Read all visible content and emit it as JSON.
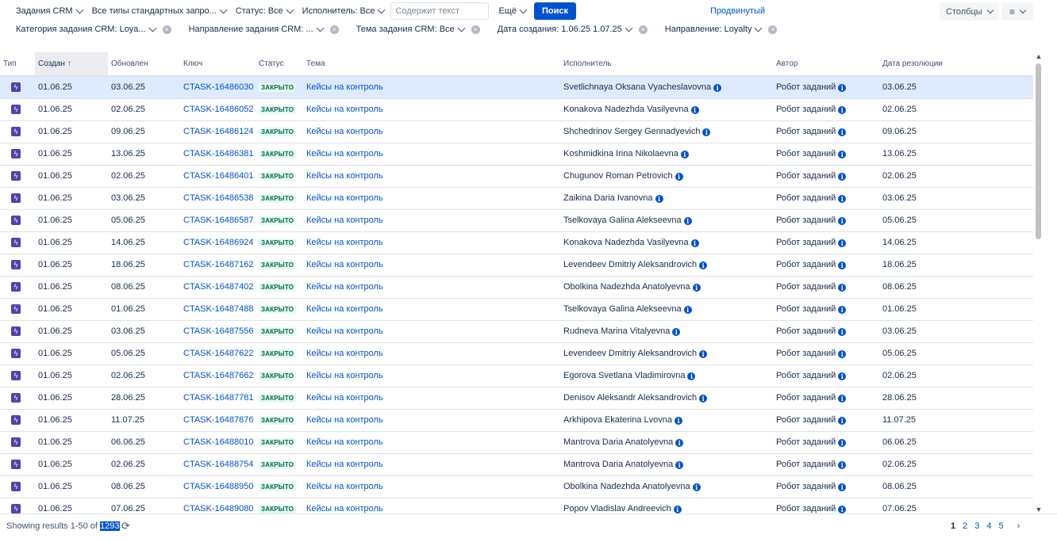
{
  "filters": {
    "row1": [
      {
        "name": "filter-project",
        "label": "Задания CRM"
      },
      {
        "name": "filter-request-type",
        "label": "Все типы стандартных запро..."
      },
      {
        "name": "filter-status",
        "label": "Статус: Все"
      },
      {
        "name": "filter-assignee",
        "label": "Исполнитель: Все"
      }
    ],
    "search_placeholder": "Содержит текст",
    "more_label": "Ещё",
    "search_button": "Поиск",
    "advanced_label": "Продвинутый",
    "columns_label": "Столбцы",
    "menu_icon": "≡",
    "row2": [
      {
        "name": "filter-task-category",
        "label": "Категория задания CRM: Loya..."
      },
      {
        "name": "filter-task-direction",
        "label": "Направление задания CRM: ..."
      },
      {
        "name": "filter-task-topic",
        "label": "Тема задания CRM: Все"
      },
      {
        "name": "filter-created-date",
        "label": "Дата создания: 1.06.25 1.07.25"
      },
      {
        "name": "filter-direction",
        "label": "Направление: Loyalty"
      }
    ]
  },
  "columns": [
    "Тип",
    "Создан",
    "Обновлен",
    "Ключ",
    "Статус",
    "Тема",
    "Исполнитель",
    "Автор",
    "Дата резолюции"
  ],
  "rows": [
    {
      "created": "01.06.25",
      "updated": "03.06.25",
      "key": "CTASK-16486030",
      "status": "ЗАКРЫТО",
      "summary": "Кейсы на контроль",
      "assignee": "Svetlichnaya Oksana Vyacheslavovna",
      "reporter": "Робот заданий",
      "resolved": "03.06.25"
    },
    {
      "created": "01.06.25",
      "updated": "02.06.25",
      "key": "CTASK-16486052",
      "status": "ЗАКРЫТО",
      "summary": "Кейсы на контроль",
      "assignee": "Konakova Nadezhda Vasilyevna",
      "reporter": "Робот заданий",
      "resolved": "02.06.25"
    },
    {
      "created": "01.06.25",
      "updated": "09.06.25",
      "key": "CTASK-16486124",
      "status": "ЗАКРЫТО",
      "summary": "Кейсы на контроль",
      "assignee": "Shchedrinov Sergey Gennadyevich",
      "reporter": "Робот заданий",
      "resolved": "09.06.25"
    },
    {
      "created": "01.06.25",
      "updated": "13.06.25",
      "key": "CTASK-16486381",
      "status": "ЗАКРЫТО",
      "summary": "Кейсы на контроль",
      "assignee": "Koshmidkina Irina Nikolaevna",
      "reporter": "Робот заданий",
      "resolved": "13.06.25"
    },
    {
      "created": "01.06.25",
      "updated": "02.06.25",
      "key": "CTASK-16486401",
      "status": "ЗАКРЫТО",
      "summary": "Кейсы на контроль",
      "assignee": "Chugunov Roman Petrovich",
      "reporter": "Робот заданий",
      "resolved": "02.06.25"
    },
    {
      "created": "01.06.25",
      "updated": "03.06.25",
      "key": "CTASK-16486538",
      "status": "ЗАКРЫТО",
      "summary": "Кейсы на контроль",
      "assignee": "Zaikina Daria Ivanovna",
      "reporter": "Робот заданий",
      "resolved": "03.06.25"
    },
    {
      "created": "01.06.25",
      "updated": "05.06.25",
      "key": "CTASK-16486587",
      "status": "ЗАКРЫТО",
      "summary": "Кейсы на контроль",
      "assignee": "Tselkovaya Galina Alekseevna",
      "reporter": "Робот заданий",
      "resolved": "05.06.25"
    },
    {
      "created": "01.06.25",
      "updated": "14.06.25",
      "key": "CTASK-16486924",
      "status": "ЗАКРЫТО",
      "summary": "Кейсы на контроль",
      "assignee": "Konakova Nadezhda Vasilyevna",
      "reporter": "Робот заданий",
      "resolved": "14.06.25"
    },
    {
      "created": "01.06.25",
      "updated": "18.06.25",
      "key": "CTASK-16487162",
      "status": "ЗАКРЫТО",
      "summary": "Кейсы на контроль",
      "assignee": "Levendeev Dmitriy Aleksandrovich",
      "reporter": "Робот заданий",
      "resolved": "18.06.25"
    },
    {
      "created": "01.06.25",
      "updated": "08.06.25",
      "key": "CTASK-16487402",
      "status": "ЗАКРЫТО",
      "summary": "Кейсы на контроль",
      "assignee": "Obolkina Nadezhda Anatolyevna",
      "reporter": "Робот заданий",
      "resolved": "08.06.25"
    },
    {
      "created": "01.06.25",
      "updated": "01.06.25",
      "key": "CTASK-16487488",
      "status": "ЗАКРЫТО",
      "summary": "Кейсы на контроль",
      "assignee": "Tselkovaya Galina Alekseevna",
      "reporter": "Робот заданий",
      "resolved": "01.06.25"
    },
    {
      "created": "01.06.25",
      "updated": "03.06.25",
      "key": "CTASK-16487556",
      "status": "ЗАКРЫТО",
      "summary": "Кейсы на контроль",
      "assignee": "Rudneva Marina Vitalyevna",
      "reporter": "Робот заданий",
      "resolved": "03.06.25"
    },
    {
      "created": "01.06.25",
      "updated": "05.06.25",
      "key": "CTASK-16487622",
      "status": "ЗАКРЫТО",
      "summary": "Кейсы на контроль",
      "assignee": "Levendeev Dmitriy Aleksandrovich",
      "reporter": "Робот заданий",
      "resolved": "05.06.25"
    },
    {
      "created": "01.06.25",
      "updated": "02.06.25",
      "key": "CTASK-16487662",
      "status": "ЗАКРЫТО",
      "summary": "Кейсы на контроль",
      "assignee": "Egorova Svetlana Vladimirovna",
      "reporter": "Робот заданий",
      "resolved": "02.06.25"
    },
    {
      "created": "01.06.25",
      "updated": "28.06.25",
      "key": "CTASK-16487781",
      "status": "ЗАКРЫТО",
      "summary": "Кейсы на контроль",
      "assignee": "Denisov Aleksandr Aleksandrovich",
      "reporter": "Робот заданий",
      "resolved": "28.06.25"
    },
    {
      "created": "01.06.25",
      "updated": "11.07.25",
      "key": "CTASK-16487876",
      "status": "ЗАКРЫТО",
      "summary": "Кейсы на контроль",
      "assignee": "Arkhipova Ekaterina Lvovna",
      "reporter": "Робот заданий",
      "resolved": "11.07.25"
    },
    {
      "created": "01.06.25",
      "updated": "06.06.25",
      "key": "CTASK-16488010",
      "status": "ЗАКРЫТО",
      "summary": "Кейсы на контроль",
      "assignee": "Mantrova Daria Anatolyevna",
      "reporter": "Робот заданий",
      "resolved": "06.06.25"
    },
    {
      "created": "01.06.25",
      "updated": "02.06.25",
      "key": "CTASK-16488754",
      "status": "ЗАКРЫТО",
      "summary": "Кейсы на контроль",
      "assignee": "Mantrova Daria Anatolyevna",
      "reporter": "Робот заданий",
      "resolved": "02.06.25"
    },
    {
      "created": "01.06.25",
      "updated": "08.06.25",
      "key": "CTASK-16488950",
      "status": "ЗАКРЫТО",
      "summary": "Кейсы на контроль",
      "assignee": "Obolkina Nadezhda Anatolyevna",
      "reporter": "Робот заданий",
      "resolved": "08.06.25"
    },
    {
      "created": "01.06.25",
      "updated": "07.06.25",
      "key": "CTASK-16489080",
      "status": "ЗАКРЫТО",
      "summary": "Кейсы на контроль",
      "assignee": "Popov Vladislav Andreevich",
      "reporter": "Робот заданий",
      "resolved": "07.06.25"
    }
  ],
  "footer": {
    "results_prefix": "Showing results 1-50 of ",
    "results_total": "1293",
    "pages": [
      "1",
      "2",
      "3",
      "4",
      "5"
    ],
    "next_icon": "›"
  },
  "icons": {
    "type": "lightning-bolt-icon",
    "info": "info-icon",
    "refresh": "refresh-icon"
  },
  "colors": {
    "accent": "#0052cc",
    "selected_row": "#deebff",
    "status_bg": "#e3fcef",
    "status_fg": "#006644",
    "type_icon": "#5243aa"
  }
}
